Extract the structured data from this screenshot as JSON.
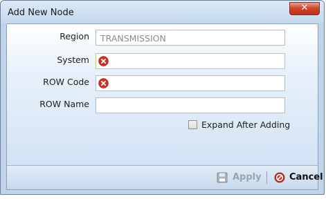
{
  "window": {
    "title": "Add New Node",
    "close_icon": "close-x-icon"
  },
  "form": {
    "fields": [
      {
        "label": "Region",
        "value": "TRANSMISSION",
        "error": false
      },
      {
        "label": "System",
        "value": "",
        "error": true
      },
      {
        "label": "ROW Code",
        "value": "",
        "error": true
      },
      {
        "label": "ROW Name",
        "value": "",
        "error": false
      }
    ],
    "expand_after_adding": {
      "label": "Expand After Adding",
      "checked": false
    }
  },
  "footer": {
    "apply_label": "Apply",
    "apply_icon": "save-icon",
    "cancel_label": "Cancel",
    "cancel_icon": "cancel-icon"
  },
  "colors": {
    "error_red": "#d0321f",
    "cancel_red": "#c8322a"
  }
}
